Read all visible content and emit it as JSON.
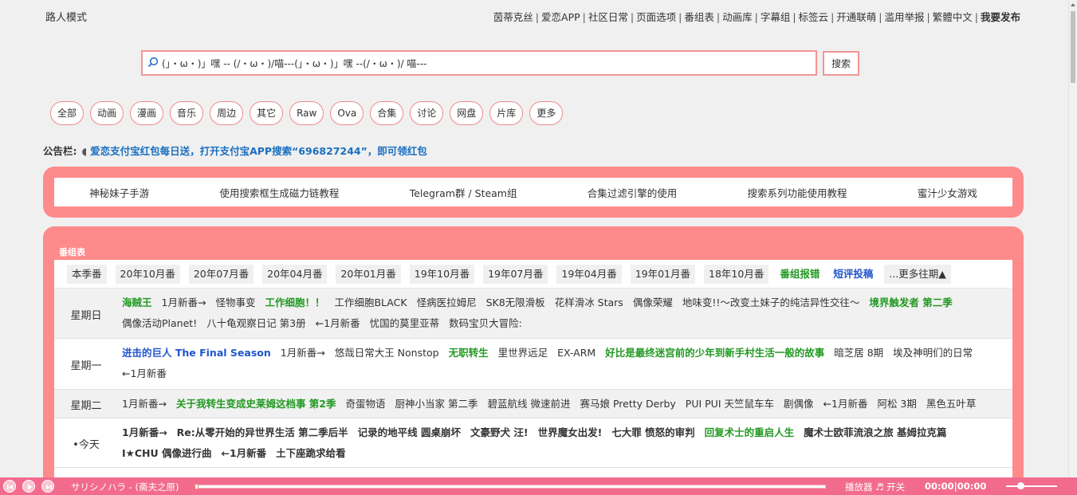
{
  "header": {
    "guest_mode": "路人模式",
    "nav": [
      "茵蒂克丝",
      "爱恋APP",
      "社区日常",
      "页面选项",
      "番组表",
      "动画库",
      "字幕组",
      "标签云",
      "开通联萌",
      "滥用举报",
      "繁體中文"
    ],
    "nav_last": "我要发布"
  },
  "search": {
    "value": "(」・ω・)」嘿 -- (/・ω・)/喵---(」・ω・)」嘿 --(/・ω・)/ 喵---",
    "button_label": "搜索"
  },
  "categories": [
    "全部",
    "动画",
    "漫画",
    "音乐",
    "周边",
    "其它",
    "Raw",
    "Ova",
    "合集",
    "讨论",
    "网盘",
    "片库",
    "更多"
  ],
  "notice": {
    "label": "公告栏:",
    "arrow": "◖",
    "text": "爱恋支付宝红包每日送，打开支付宝APP搜索“696827244”，即可领红包"
  },
  "quick_links": [
    "神秘妹子手游",
    "使用搜索框生成磁力链教程",
    "Telegram群 / Steam组",
    "合集过滤引擎的使用",
    "搜索系列功能使用教程",
    "蜜汁少女游戏"
  ],
  "schedule": {
    "title": "番组表",
    "seasons": [
      {
        "label": "本季番",
        "style": "n"
      },
      {
        "label": "20年10月番",
        "style": "n"
      },
      {
        "label": "20年07月番",
        "style": "n"
      },
      {
        "label": "20年04月番",
        "style": "n"
      },
      {
        "label": "20年01月番",
        "style": "n"
      },
      {
        "label": "19年10月番",
        "style": "n"
      },
      {
        "label": "19年07月番",
        "style": "n"
      },
      {
        "label": "19年04月番",
        "style": "n"
      },
      {
        "label": "19年01月番",
        "style": "n"
      },
      {
        "label": "18年10月番",
        "style": "n"
      },
      {
        "label": "番组报错",
        "style": "g"
      },
      {
        "label": "短评投稿",
        "style": "b"
      },
      {
        "label": "...更多往期▲",
        "style": "more"
      }
    ],
    "days": [
      {
        "name": "星期日",
        "bg": "gray",
        "items": [
          {
            "t": "海贼王",
            "s": "g"
          },
          {
            "t": "1月新番→",
            "s": ""
          },
          {
            "t": "怪物事变",
            "s": ""
          },
          {
            "t": "工作细胞！！",
            "s": "g"
          },
          {
            "t": "工作细胞BLACK",
            "s": ""
          },
          {
            "t": "怪病医拉姆尼",
            "s": ""
          },
          {
            "t": "SK8无限滑板",
            "s": ""
          },
          {
            "t": "花样滑冰 Stars",
            "s": ""
          },
          {
            "t": "偶像荣耀",
            "s": ""
          },
          {
            "t": "地味变!!～改变土妹子的纯洁异性交往～",
            "s": ""
          },
          {
            "t": "境界触发者 第二季",
            "s": "g"
          },
          {
            "t": "偶像活动Planet!",
            "s": ""
          },
          {
            "t": "八十龟观察日记 第3册",
            "s": ""
          },
          {
            "t": "←1月新番",
            "s": ""
          },
          {
            "t": "忧国的莫里亚蒂",
            "s": ""
          },
          {
            "t": "数码宝贝大冒险:",
            "s": ""
          }
        ]
      },
      {
        "name": "星期一",
        "bg": "white",
        "items": [
          {
            "t": "进击的巨人 The Final Season",
            "s": "b"
          },
          {
            "t": "1月新番→",
            "s": ""
          },
          {
            "t": "悠哉日常大王 Nonstop",
            "s": ""
          },
          {
            "t": "无职转生",
            "s": "g"
          },
          {
            "t": "里世界远足",
            "s": ""
          },
          {
            "t": "EX-ARM",
            "s": ""
          },
          {
            "t": "好比是最终迷宫前的少年到新手村生活一般的故事",
            "s": "g"
          },
          {
            "t": "暗芝居 8期",
            "s": ""
          },
          {
            "t": "埃及神明们的日常",
            "s": ""
          },
          {
            "t": "←1月新番",
            "s": ""
          }
        ]
      },
      {
        "name": "星期二",
        "bg": "gray",
        "items": [
          {
            "t": "1月新番→",
            "s": ""
          },
          {
            "t": "关于我转生变成史莱姆这档事 第2季",
            "s": "g"
          },
          {
            "t": "奇蛋物语",
            "s": ""
          },
          {
            "t": "厨神小当家 第二季",
            "s": ""
          },
          {
            "t": "碧蓝航线 微速前进",
            "s": ""
          },
          {
            "t": "赛马娘 Pretty Derby",
            "s": ""
          },
          {
            "t": "PUI PUI 天竺鼠车车",
            "s": ""
          },
          {
            "t": "剧偶像",
            "s": ""
          },
          {
            "t": "←1月新番",
            "s": ""
          },
          {
            "t": "阿松 3期",
            "s": ""
          },
          {
            "t": "黑色五叶草",
            "s": ""
          }
        ]
      },
      {
        "name": "•今天",
        "bg": "white",
        "today": true,
        "items": [
          {
            "t": "1月新番→",
            "s": ""
          },
          {
            "t": "Re:从零开始的异世界生活 第二季后半",
            "s": ""
          },
          {
            "t": "记录的地平线 圆桌崩坏",
            "s": ""
          },
          {
            "t": "文豪野犬 汪!",
            "s": ""
          },
          {
            "t": "世界魔女出发!",
            "s": ""
          },
          {
            "t": "七大罪 愤怒的审判",
            "s": ""
          },
          {
            "t": "回复术士的重启人生",
            "s": "g"
          },
          {
            "t": "魔术士欧菲流浪之旅 基姆拉克篇",
            "s": ""
          },
          {
            "t": "I★CHU 偶像进行曲",
            "s": ""
          },
          {
            "t": "←1月新番",
            "s": ""
          },
          {
            "t": "土下座跪求给看",
            "s": ""
          }
        ]
      }
    ]
  },
  "player": {
    "title": "サリシノハラ - (斋夫之原)",
    "label": "播放器 ♬ 开关",
    "time": "00:00|00:00",
    "progress": 0,
    "volume": 0.25
  }
}
